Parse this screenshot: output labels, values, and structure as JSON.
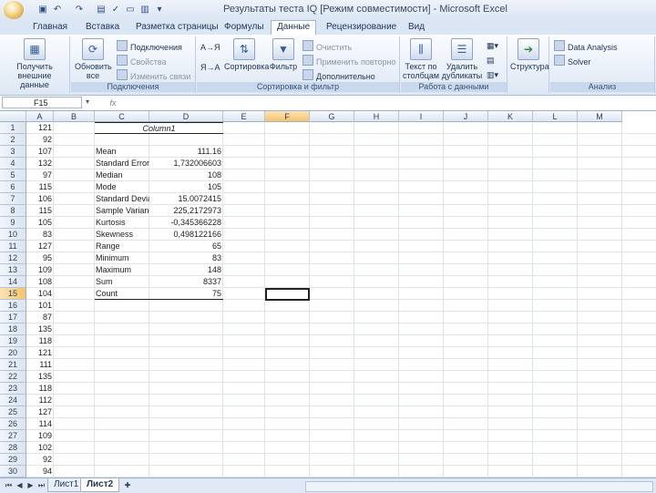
{
  "window": {
    "title": "Результаты теста IQ  [Режим совместимости] - Microsoft Excel"
  },
  "tabs": [
    "Главная",
    "Вставка",
    "Разметка страницы",
    "Формулы",
    "Данные",
    "Рецензирование",
    "Вид"
  ],
  "active_tab": "Данные",
  "ribbon": {
    "get_external": "Получить внешние данные",
    "refresh_all": "Обновить все",
    "connections": "Подключения",
    "properties": "Свойства",
    "edit_links": "Изменить связи",
    "group_connections": "Подключения",
    "sort_az": "А→Я",
    "sort_za": "Я→А",
    "sort": "Сортировка",
    "filter": "Фильтр",
    "clear": "Очистить",
    "reapply": "Применить повторно",
    "advanced": "Дополнительно",
    "group_sort": "Сортировка и фильтр",
    "text_to_columns": "Текст по столбцам",
    "remove_duplicates": "Удалить дубликаты",
    "group_data_tools": "Работа с данными",
    "outline": "Структура",
    "data_analysis": "Data Analysis",
    "solver": "Solver",
    "group_analysis": "Анализ"
  },
  "formula_bar": {
    "name_box": "F15",
    "fx": "fx",
    "content": ""
  },
  "columns": [
    "A",
    "B",
    "C",
    "D",
    "E",
    "F",
    "G",
    "H",
    "I",
    "J",
    "K",
    "L",
    "M"
  ],
  "selected_col": "F",
  "selected_row": "15",
  "rows": [
    "1",
    "2",
    "3",
    "4",
    "5",
    "6",
    "7",
    "8",
    "9",
    "10",
    "11",
    "12",
    "13",
    "14",
    "15",
    "16",
    "17",
    "18",
    "19",
    "20",
    "21",
    "22",
    "23",
    "24",
    "25",
    "26",
    "27",
    "28",
    "29",
    "30"
  ],
  "col_a": [
    "121",
    "92",
    "107",
    "132",
    "97",
    "115",
    "106",
    "115",
    "105",
    "83",
    "127",
    "95",
    "109",
    "108",
    "104",
    "101",
    "87",
    "135",
    "118",
    "121",
    "111",
    "135",
    "118",
    "112",
    "127",
    "114",
    "109",
    "102",
    "92",
    "94"
  ],
  "stats": {
    "header": "Column1",
    "rows": [
      {
        "label": "Mean",
        "value": "111.16"
      },
      {
        "label": "Standard Error",
        "value": "1,732006603"
      },
      {
        "label": "Median",
        "value": "108"
      },
      {
        "label": "Mode",
        "value": "105"
      },
      {
        "label": "Standard Deviatio",
        "value": "15.0072415"
      },
      {
        "label": "Sample Variance",
        "value": "225,2172973"
      },
      {
        "label": "Kurtosis",
        "value": "-0,345366228"
      },
      {
        "label": "Skewness",
        "value": "0,498122166"
      },
      {
        "label": "Range",
        "value": "65"
      },
      {
        "label": "Minimum",
        "value": "83"
      },
      {
        "label": "Maximum",
        "value": "148"
      },
      {
        "label": "Sum",
        "value": "8337"
      },
      {
        "label": "Count",
        "value": "75"
      }
    ]
  },
  "sheets": [
    "Лист1",
    "Лист2"
  ],
  "active_sheet": "Лист2"
}
